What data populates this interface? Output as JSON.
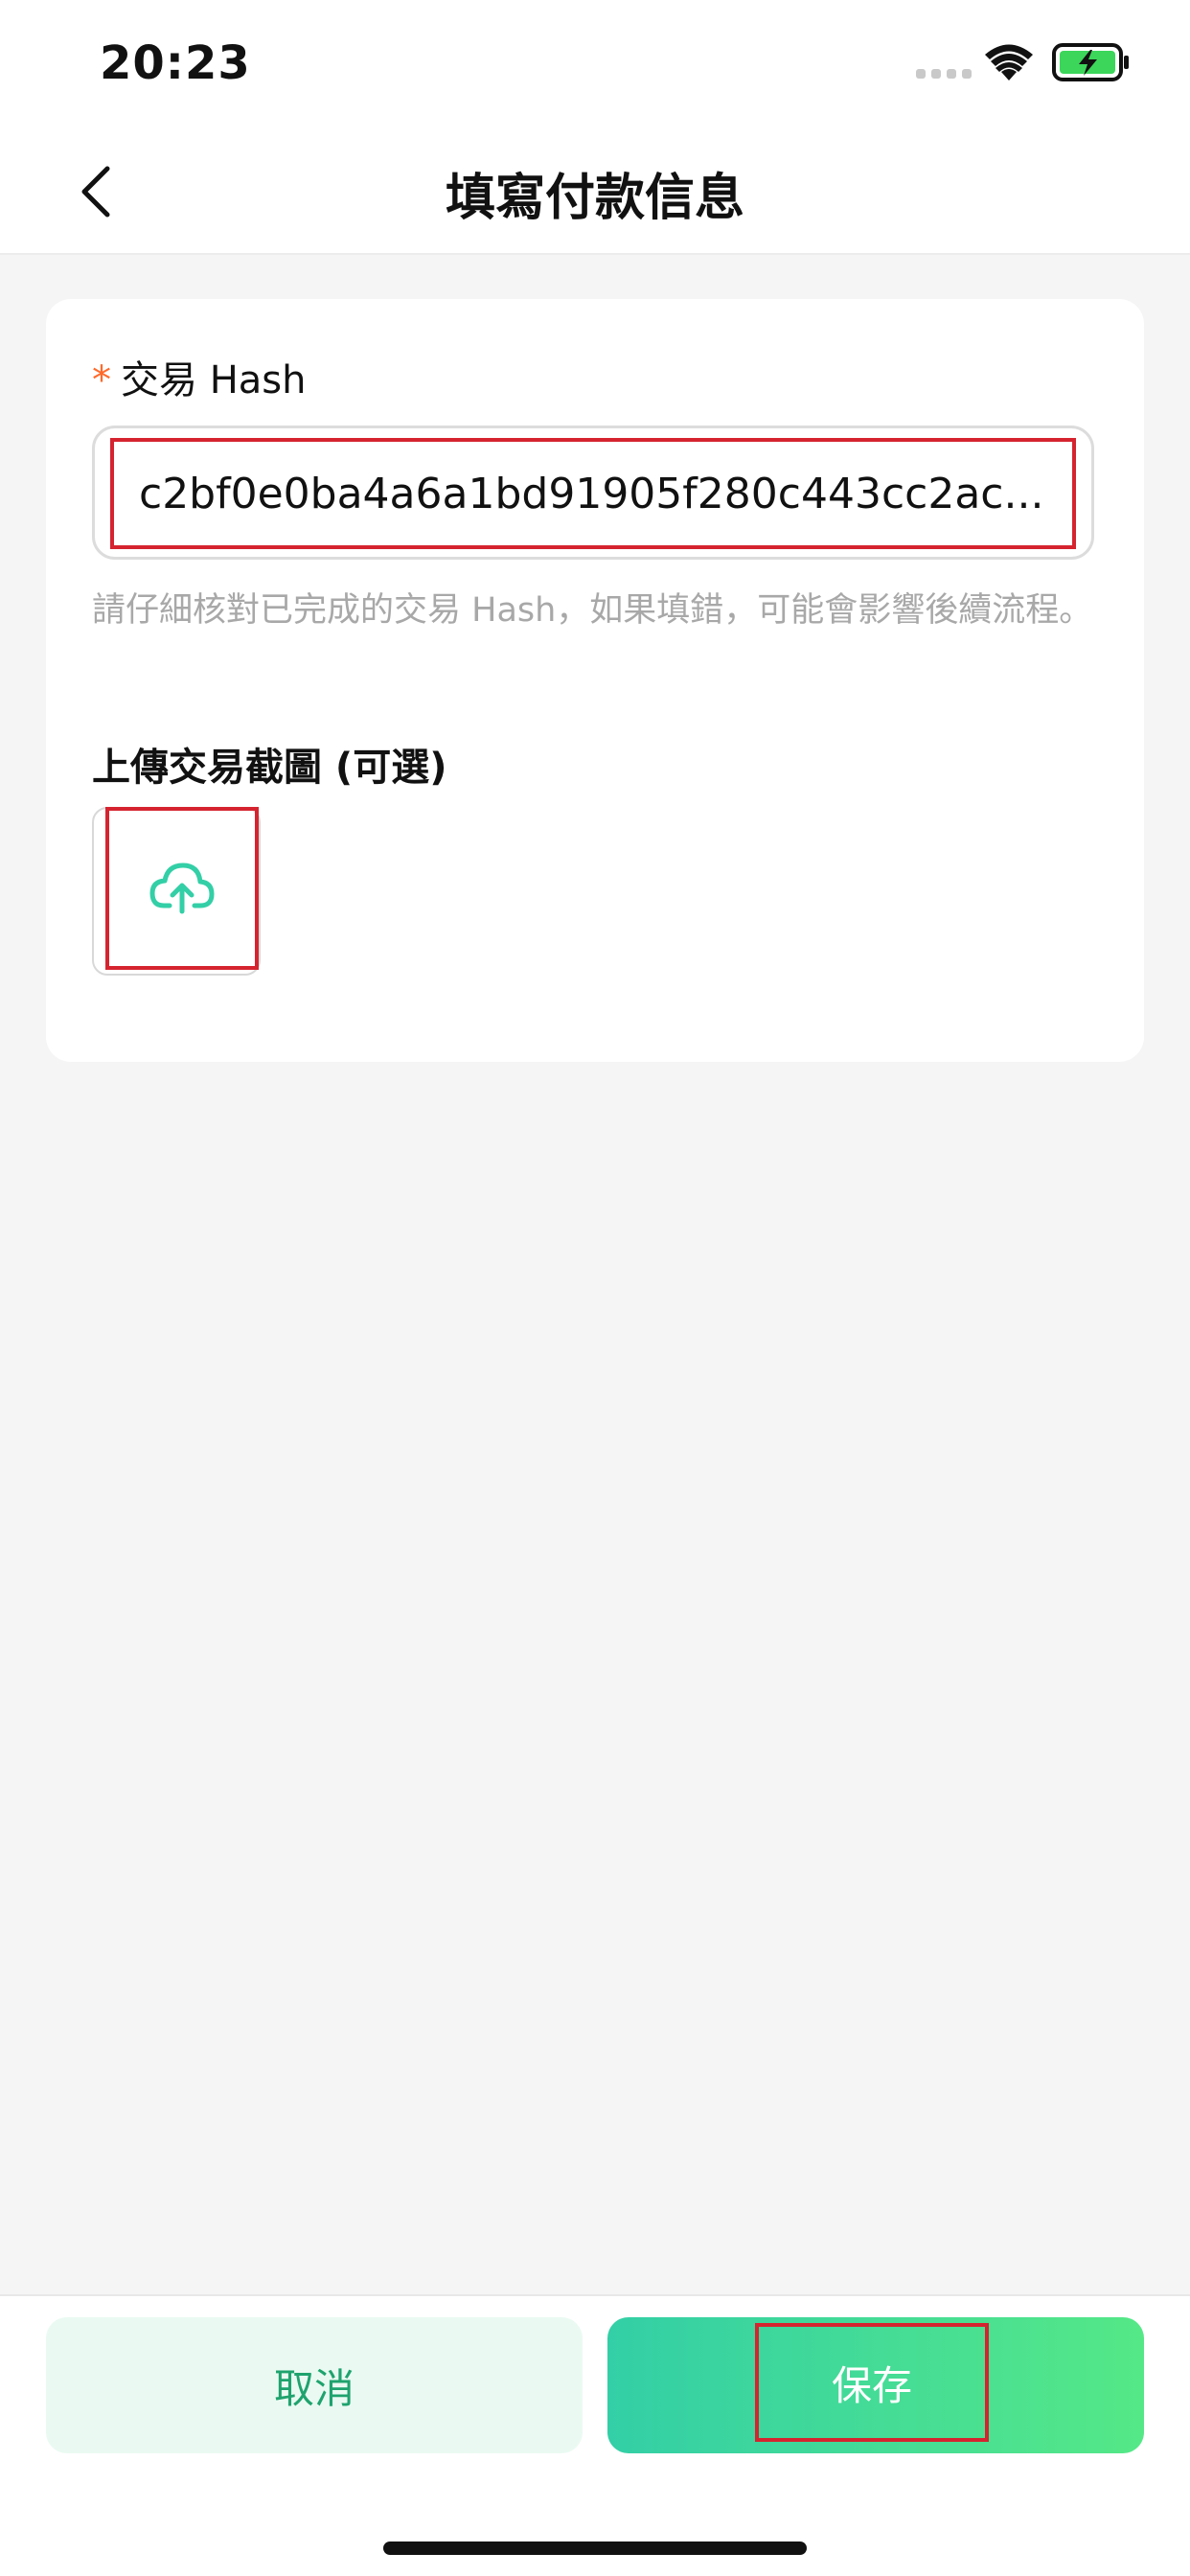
{
  "status_bar": {
    "time": "20:23"
  },
  "nav": {
    "title": "填寫付款信息"
  },
  "form": {
    "hash": {
      "required_mark": "*",
      "label": "交易 Hash",
      "value": "c2bf0e0ba4a6a1bd91905f280c443cc2ac...",
      "helper": "請仔細核對已完成的交易 Hash，如果填錯，可能會影響後續流程。"
    },
    "upload": {
      "label": "上傳交易截圖 (可選)"
    }
  },
  "actions": {
    "cancel_label": "取消",
    "save_label": "保存"
  },
  "colors": {
    "accent": "#33cfa6",
    "accent_end": "#55e887",
    "required": "#ff6a2b",
    "highlight": "#d5242f"
  }
}
